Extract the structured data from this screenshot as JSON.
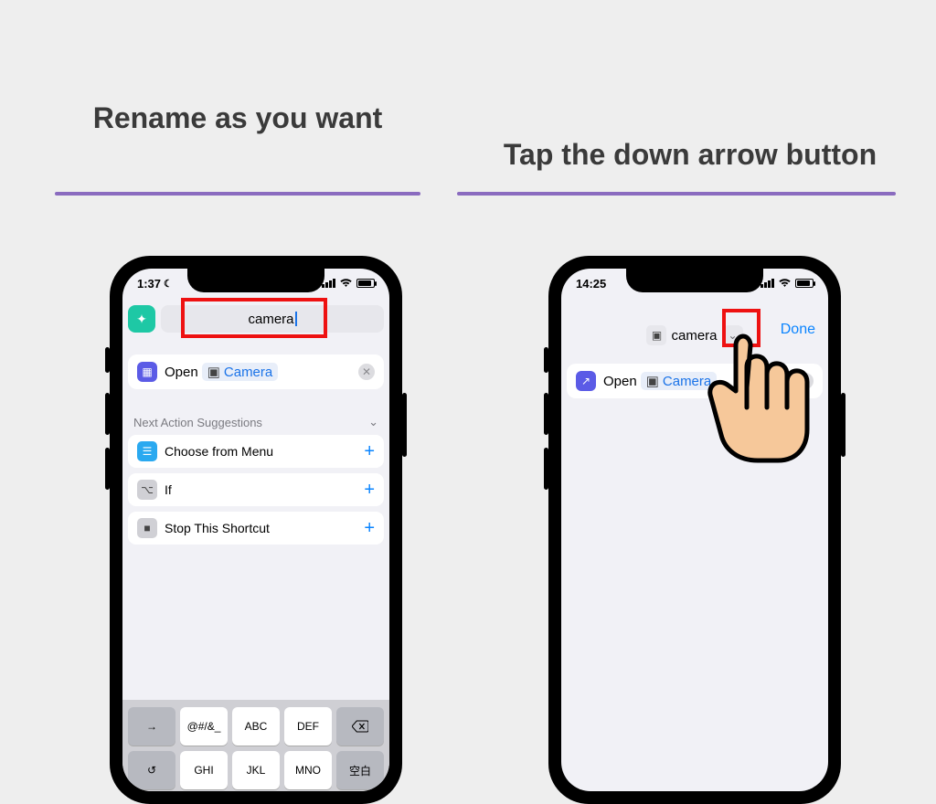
{
  "captions": {
    "left": "Rename as you want",
    "right": "Tap the down arrow button"
  },
  "left_phone": {
    "time": "1:37",
    "title_value": "camera",
    "open_label": "Open",
    "open_app": "Camera",
    "suggestions_header": "Next Action Suggestions",
    "suggestions": [
      {
        "icon": "menu",
        "label": "Choose from Menu"
      },
      {
        "icon": "if",
        "label": "If"
      },
      {
        "icon": "stop",
        "label": "Stop This Shortcut"
      }
    ],
    "keyboard": {
      "row1": [
        "→",
        "@#/&_",
        "ABC",
        "DEF",
        "⌫"
      ],
      "row2": [
        "↺",
        "GHI",
        "JKL",
        "MNO",
        "空白"
      ]
    }
  },
  "right_phone": {
    "time": "14:25",
    "title_value": "camera",
    "done_label": "Done",
    "open_label": "Open",
    "open_app": "Camera"
  }
}
